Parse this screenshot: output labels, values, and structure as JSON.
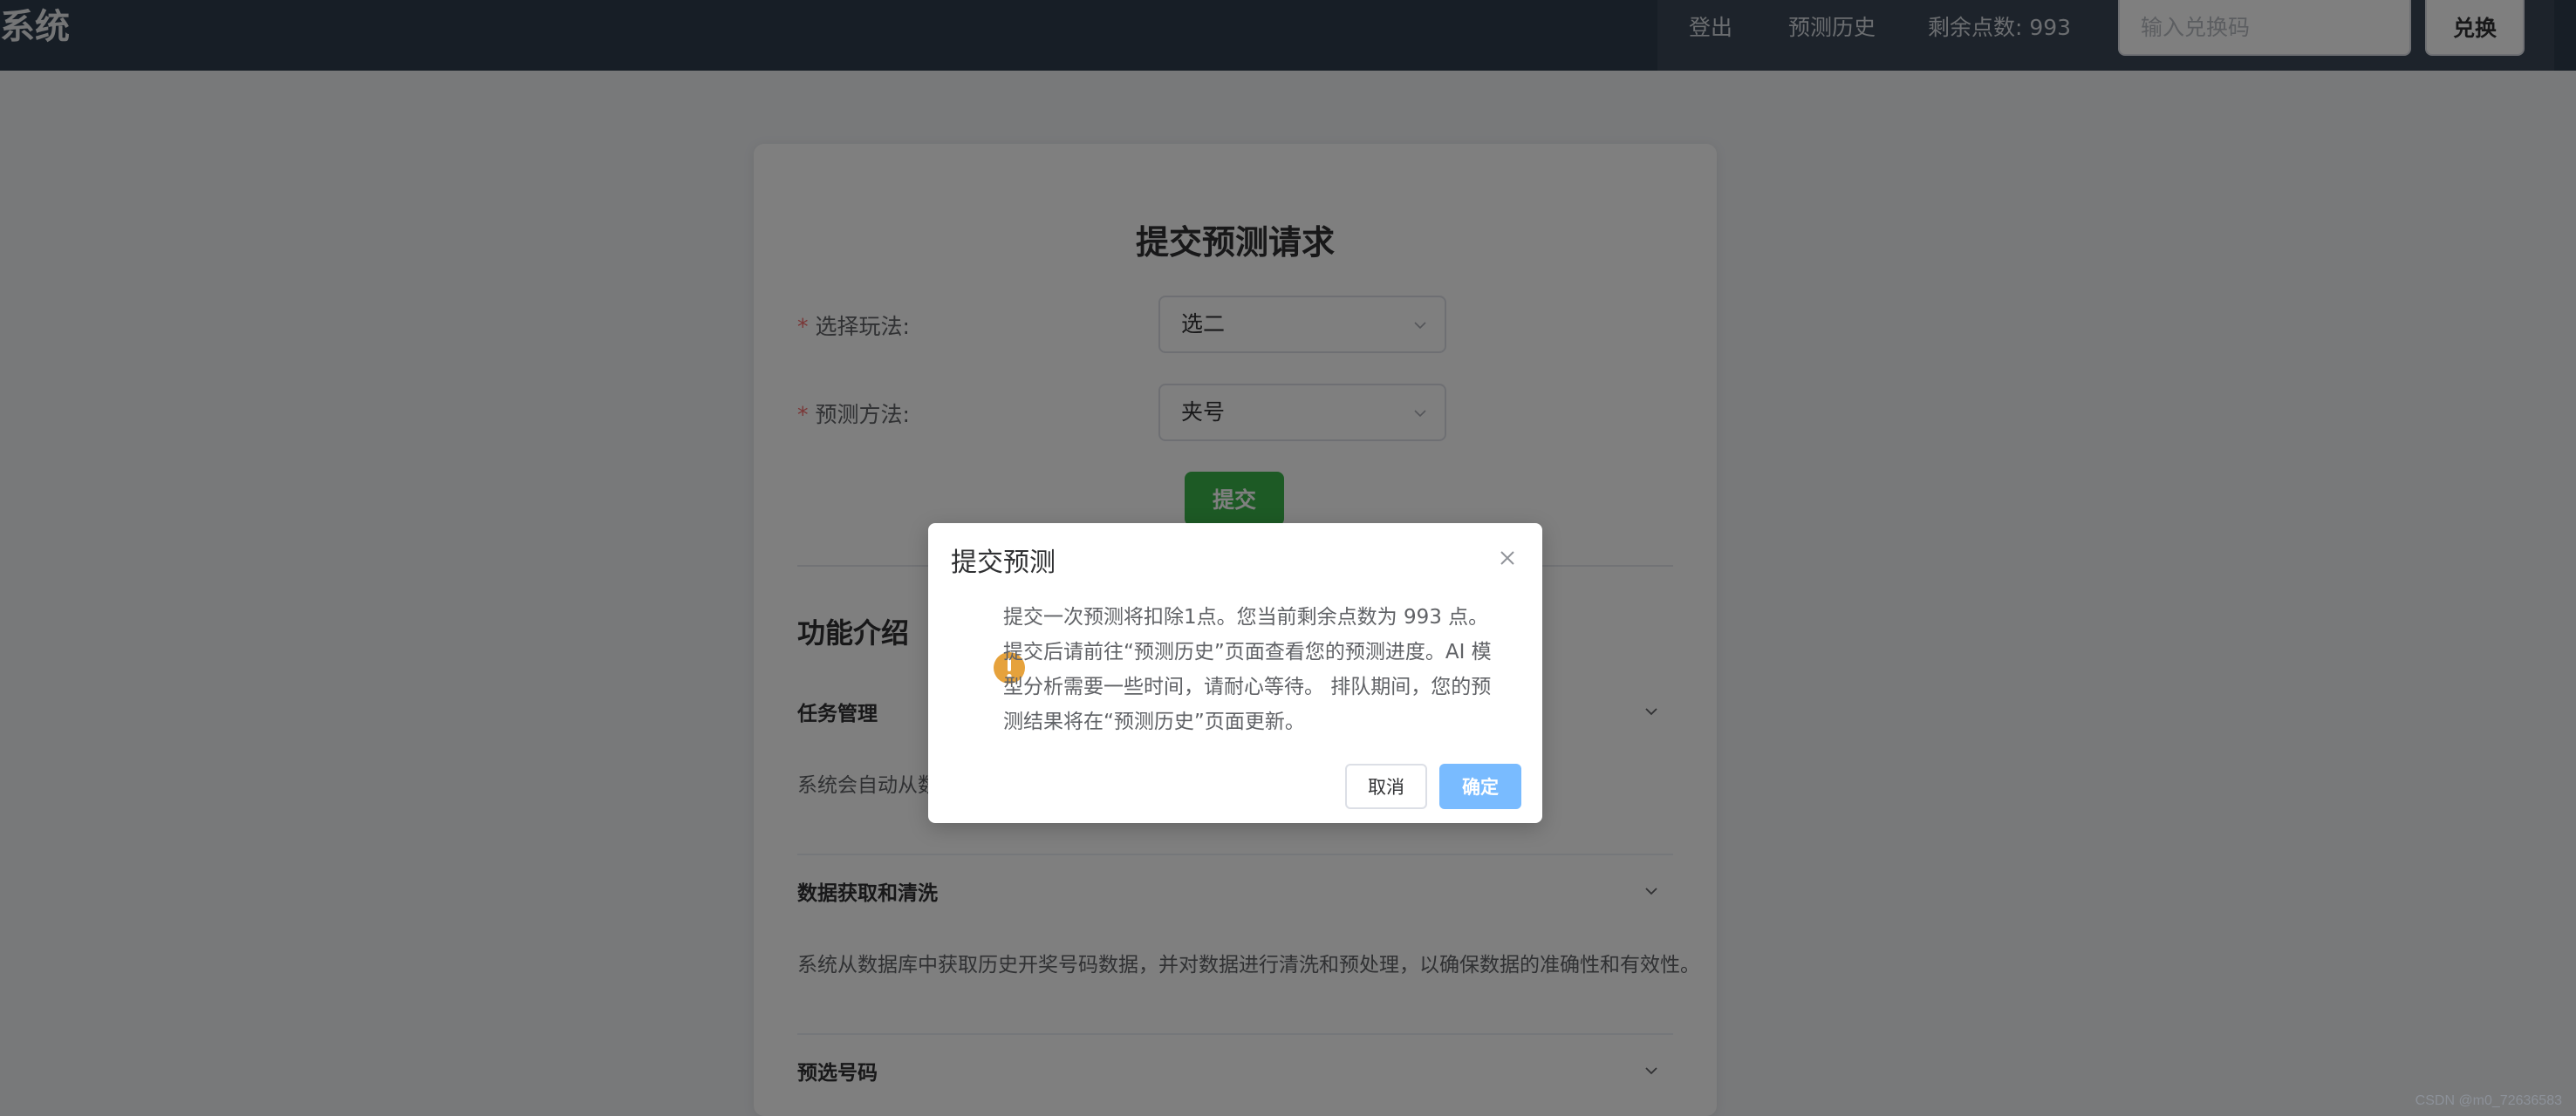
{
  "header": {
    "brand": "系统",
    "nav": {
      "logout": "登出",
      "history": "预测历史",
      "points": "剩余点数: 993"
    },
    "redeem": {
      "placeholder": "输入兑换码",
      "button": "兑换"
    }
  },
  "card": {
    "title": "提交预测请求",
    "form": {
      "play": {
        "label": "选择玩法:",
        "value": "选二"
      },
      "method": {
        "label": "预测方法:",
        "value": "夹号"
      },
      "submit": "提交"
    },
    "intro": {
      "title": "功能介绍",
      "items": [
        {
          "title": "任务管理",
          "body": "系统会自动从数"
        },
        {
          "title": "数据获取和清洗",
          "body": "系统从数据库中获取历史开奖号码数据，并对数据进行清洗和预处理，以确保数据的准确性和有效性。"
        },
        {
          "title": "预选号码",
          "body": ""
        }
      ]
    }
  },
  "dialog": {
    "title": "提交预测",
    "message": "提交一次预测将扣除1点。您当前剩余点数为 993 点。 提交后请前往“预测历史”页面查看您的预测进度。AI 模型分析需要一些时间，请耐心等待。 排队期间，您的预测结果将在“预测历史”页面更新。",
    "cancel": "取消",
    "confirm": "确定"
  },
  "watermark": "CSDN @m0_72636583",
  "colors": {
    "topbar": "#2f3d4c",
    "submit_green": "#3bb54a",
    "confirm_blue": "#79bbff",
    "warning": "#e6a23c",
    "required": "#f56c6c"
  }
}
